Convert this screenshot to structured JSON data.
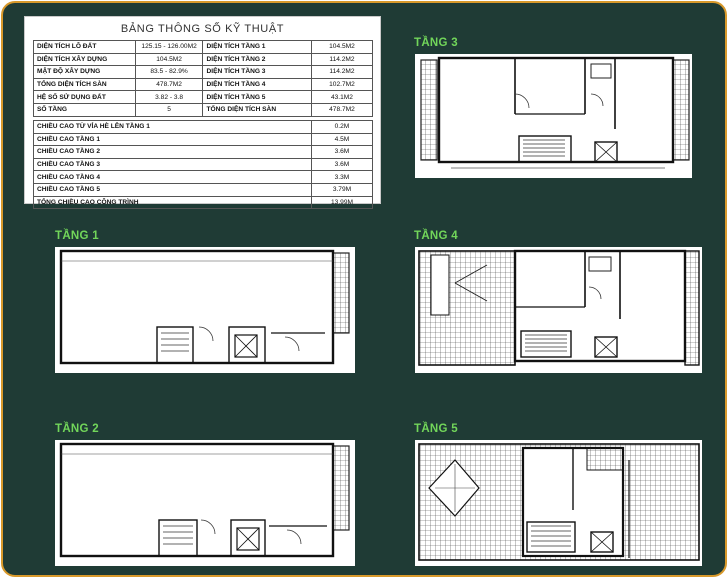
{
  "spec": {
    "title": "BẢNG THÔNG SỐ KỸ THUẬT",
    "rows_left": [
      {
        "label": "DIỆN TÍCH LÔ ĐẤT",
        "value": "125.15 - 126.00M2"
      },
      {
        "label": "DIỆN TÍCH XÂY DỰNG",
        "value": "104.5M2"
      },
      {
        "label": "MẬT ĐỘ XÂY DỰNG",
        "value": "83.5 - 82.9%"
      },
      {
        "label": "TỔNG DIỆN TÍCH SÀN",
        "value": "478.7M2"
      },
      {
        "label": "HỆ SỐ SỬ DỤNG ĐẤT",
        "value": "3.82 - 3.8"
      },
      {
        "label": "SỐ TẦNG",
        "value": "5"
      }
    ],
    "rows_right": [
      {
        "label": "DIỆN TÍCH TẦNG 1",
        "value": "104.5M2"
      },
      {
        "label": "DIỆN TÍCH TẦNG 2",
        "value": "114.2M2"
      },
      {
        "label": "DIỆN TÍCH TẦNG 3",
        "value": "114.2M2"
      },
      {
        "label": "DIỆN TÍCH TẦNG 4",
        "value": "102.7M2"
      },
      {
        "label": "DIỆN TÍCH TẦNG 5",
        "value": "43.1M2"
      },
      {
        "label": "TỔNG DIỆN TÍCH SÀN",
        "value": "478.7M2"
      }
    ],
    "heights": [
      {
        "label": "CHIỀU CAO TỪ VỈA HÈ LÊN TẦNG 1",
        "value": "0.2M"
      },
      {
        "label": "CHIỀU CAO TẦNG 1",
        "value": "4.5M"
      },
      {
        "label": "CHIỀU CAO TẦNG 2",
        "value": "3.6M"
      },
      {
        "label": "CHIỀU CAO TẦNG 3",
        "value": "3.6M"
      },
      {
        "label": "CHIỀU CAO TẦNG 4",
        "value": "3.3M"
      },
      {
        "label": "CHIỀU CAO TẦNG 5",
        "value": "3.79M"
      },
      {
        "label": "TỔNG CHIỀU CAO CÔNG TRÌNH",
        "value": "13.99M"
      }
    ]
  },
  "floors": {
    "f1": "TẦNG 1",
    "f2": "TẦNG 2",
    "f3": "TẦNG 3",
    "f4": "TẦNG 4",
    "f5": "TẦNG 5"
  },
  "colors": {
    "background": "#1f3b35",
    "border": "#d8992b",
    "label": "#72d65a"
  }
}
